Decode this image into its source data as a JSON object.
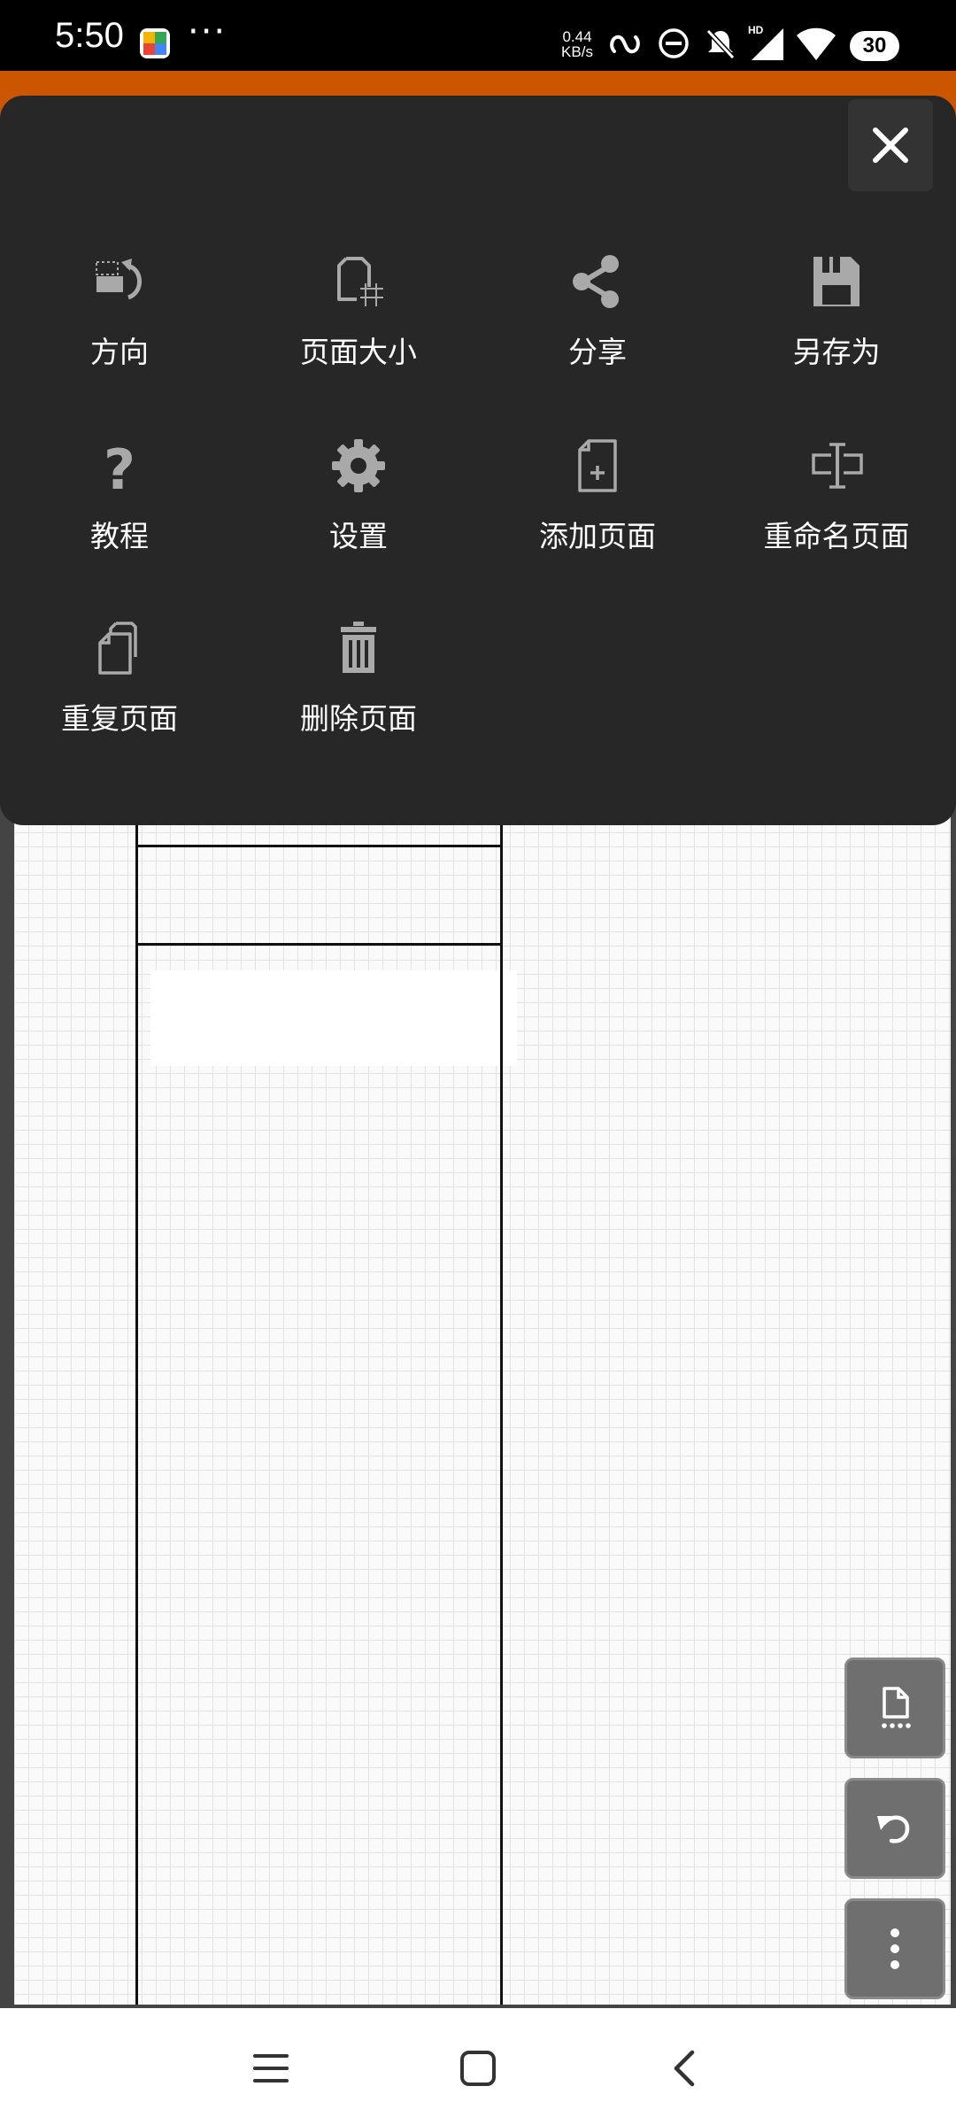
{
  "status_bar": {
    "time": "5:50",
    "more": "···",
    "net_speed_value": "0.44",
    "net_speed_unit": "KB/s",
    "hd_label": "HD",
    "battery": "30"
  },
  "menu": {
    "items": [
      {
        "label": "方向",
        "icon": "orientation-icon"
      },
      {
        "label": "页面大小",
        "icon": "page-size-icon"
      },
      {
        "label": "分享",
        "icon": "share-icon"
      },
      {
        "label": "另存为",
        "icon": "save-as-icon"
      },
      {
        "label": "教程",
        "icon": "help-icon"
      },
      {
        "label": "设置",
        "icon": "gear-icon"
      },
      {
        "label": "添加页面",
        "icon": "add-page-icon"
      },
      {
        "label": "重命名页面",
        "icon": "rename-icon"
      },
      {
        "label": "重复页面",
        "icon": "duplicate-page-icon"
      },
      {
        "label": "删除页面",
        "icon": "trash-icon"
      }
    ],
    "close_icon": "close-icon"
  },
  "fabs": [
    {
      "icon": "page-options-icon"
    },
    {
      "icon": "undo-icon"
    },
    {
      "icon": "more-vertical-icon"
    }
  ],
  "nav_bar": {
    "icons": [
      "menu-icon",
      "home-icon",
      "back-icon"
    ]
  },
  "colors": {
    "toolbar": "#cc5500",
    "dialog_bg": "#272727",
    "icon_gray": "#a9a9a9"
  }
}
